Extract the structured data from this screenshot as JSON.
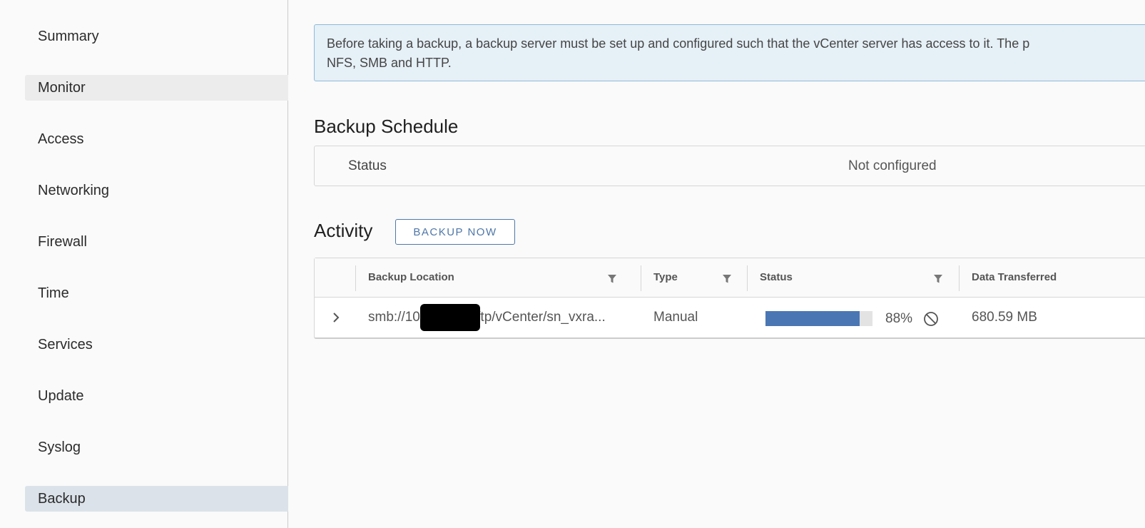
{
  "sidebar": {
    "items": [
      {
        "label": "Summary"
      },
      {
        "label": "Monitor"
      },
      {
        "label": "Access"
      },
      {
        "label": "Networking"
      },
      {
        "label": "Firewall"
      },
      {
        "label": "Time"
      },
      {
        "label": "Services"
      },
      {
        "label": "Update"
      },
      {
        "label": "Syslog"
      },
      {
        "label": "Backup"
      }
    ],
    "active": "Backup"
  },
  "info_alert": {
    "line1": "Before taking a backup, a backup server must be set up and configured such that the vCenter server has access to it. The p",
    "line2": "NFS, SMB and HTTP."
  },
  "backup_schedule": {
    "title": "Backup Schedule",
    "status_label": "Status",
    "status_value": "Not configured"
  },
  "activity": {
    "title": "Activity",
    "backup_now_label": "BACKUP NOW",
    "columns": [
      "Backup Location",
      "Type",
      "Status",
      "Data Transferred"
    ],
    "rows": [
      {
        "location_prefix": "smb://10",
        "location_suffix": "/ftp/vCenter/sn_vxra...",
        "type": "Manual",
        "progress_percent": 88,
        "progress_label": "88%",
        "data_transferred": "680.59 MB"
      }
    ]
  },
  "colors": {
    "accent": "#4f77a8",
    "progress": "#4a77b4",
    "alert_bg": "#e6f0f7",
    "active_nav": "#dbe2ea"
  },
  "icons": [
    "filter-icon",
    "chevron-right-icon",
    "cancel-icon"
  ]
}
